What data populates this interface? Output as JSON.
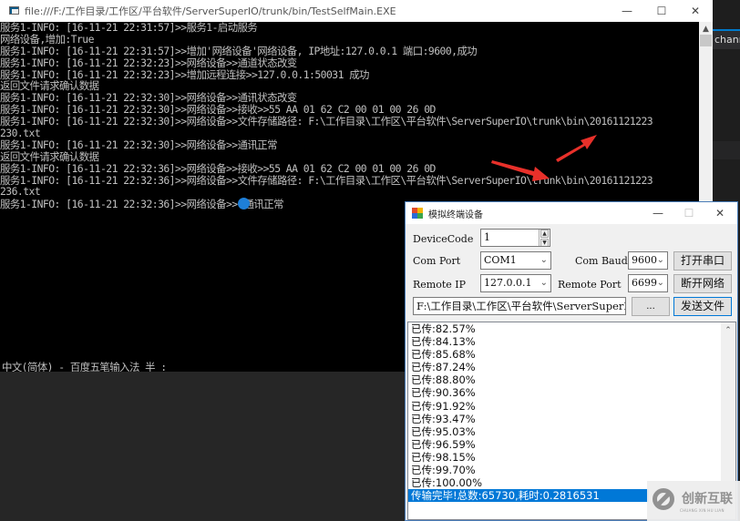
{
  "background": {
    "ide_tab_label": "channel"
  },
  "console": {
    "title": "file:///F:/工作目录/工作区/平台软件/ServerSuperIO/trunk/bin/TestSelfMain.EXE",
    "controls": {
      "minimize": "—",
      "maximize": "☐",
      "close": "✕"
    },
    "lines": [
      "服务1-INFO: [16-11-21 22:31:57]>>服务1-启动服务",
      "网络设备,增加:True",
      "服务1-INFO: [16-11-21 22:31:57]>>增加'网络设备'网络设备, IP地址:127.0.0.1 端口:9600,成功",
      "服务1-INFO: [16-11-21 22:32:23]>>网络设备>>通道状态改变",
      "服务1-INFO: [16-11-21 22:32:23]>>增加远程连接>>127.0.0.1:50031 成功",
      "返回文件请求确认数据",
      "服务1-INFO: [16-11-21 22:32:30]>>网络设备>>通讯状态改变",
      "服务1-INFO: [16-11-21 22:32:30]>>网络设备>>接收>>55 AA 01 62 C2 00 01 00 26 0D",
      "服务1-INFO: [16-11-21 22:32:30]>>网络设备>>文件存储路径: F:\\工作目录\\工作区\\平台软件\\ServerSuperIO\\trunk\\bin\\20161121223",
      "230.txt",
      "服务1-INFO: [16-11-21 22:32:30]>>网络设备>>通讯正常",
      "返回文件请求确认数据",
      "服务1-INFO: [16-11-21 22:32:36]>>网络设备>>接收>>55 AA 01 62 C2 00 01 00 26 0D",
      "服务1-INFO: [16-11-21 22:32:36]>>网络设备>>文件存储路径: F:\\工作目录\\工作区\\平台软件\\ServerSuperIO\\trunk\\bin\\20161121223",
      "236.txt"
    ],
    "last_line_prefix": "服务1-INFO: [16-11-21 22:32:36]>>网络设备>>",
    "last_line_suffix": "通讯正常",
    "ime_status": "中文(简体) - 百度五笔输入法 半 :"
  },
  "dialog": {
    "title": "模拟终端设备",
    "controls": {
      "minimize": "—",
      "maximize": "☐",
      "close": "✕"
    },
    "device_code": {
      "label": "DeviceCode",
      "value": "1"
    },
    "com_port": {
      "label": "Com Port",
      "value": "COM1"
    },
    "com_baud": {
      "label": "Com Baud",
      "value": "9600"
    },
    "remote_ip": {
      "label": "Remote IP",
      "value": "127.0.0.1"
    },
    "remote_port": {
      "label": "Remote Port",
      "value": "6699"
    },
    "file_path": "F:\\工作目录\\工作区\\平台软件\\ServerSuperIO\\trunk\\bin",
    "buttons": {
      "open_serial": "打开串口",
      "disconnect_network": "断开网络",
      "browse": "...",
      "send_file": "发送文件"
    },
    "log_items": [
      "已传:82.57%",
      "已传:84.13%",
      "已传:85.68%",
      "已传:87.24%",
      "已传:88.80%",
      "已传:90.36%",
      "已传:91.92%",
      "已传:93.47%",
      "已传:95.03%",
      "已传:96.59%",
      "已传:98.15%",
      "已传:99.70%",
      "已传:100.00%"
    ],
    "log_selected": "传输完毕!总数:65730,耗时:0.2816531"
  },
  "watermark": {
    "name": "创新互联",
    "sub": "CHUANG XIN HU LIAN"
  },
  "colors": {
    "selection": "#0078d7",
    "arrow": "#e8302a",
    "console_bg": "#000000",
    "console_text": "#c0c0c0"
  }
}
